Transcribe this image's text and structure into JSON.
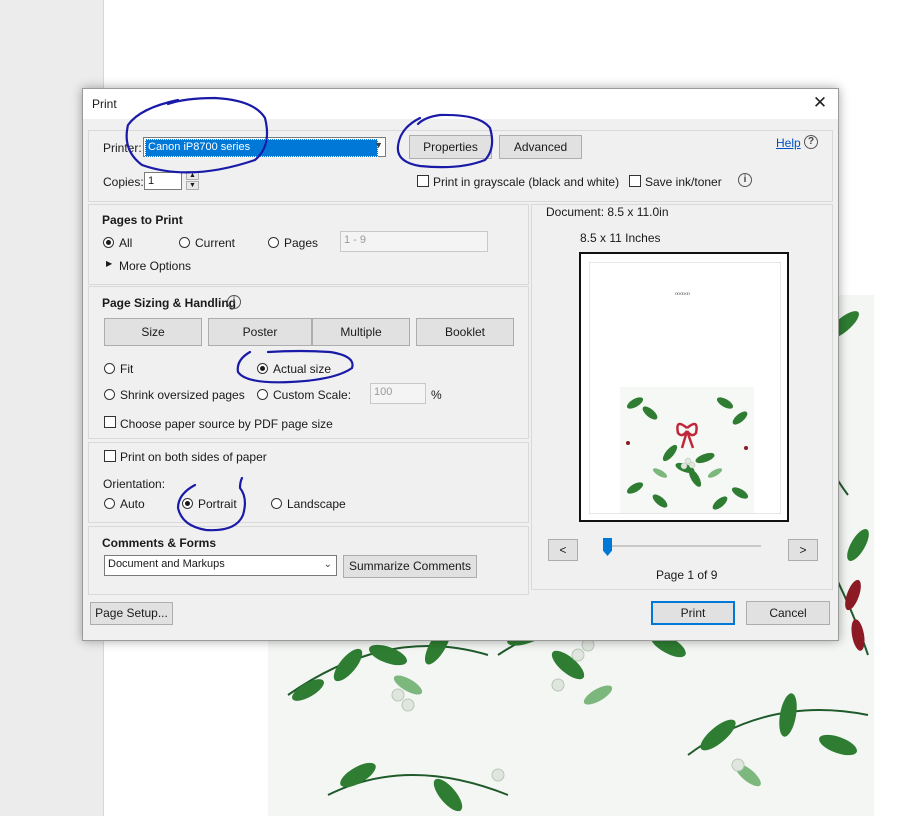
{
  "dialog": {
    "title": "Print"
  },
  "printer": {
    "label": "Printer:",
    "selected": "Canon iP8700 series",
    "properties_label": "Properties",
    "advanced_label": "Advanced",
    "help_label": "Help",
    "copies_label": "Copies:",
    "copies_value": "1",
    "grayscale_label": "Print in grayscale (black and white)",
    "grayscale_checked": false,
    "save_ink_label": "Save ink/toner",
    "save_ink_checked": false
  },
  "pages_to_print": {
    "heading": "Pages to Print",
    "all_label": "All",
    "current_label": "Current",
    "pages_label": "Pages",
    "pages_placeholder": "1 - 9",
    "more_options_label": "More Options",
    "selected": "All"
  },
  "sizing": {
    "heading": "Page Sizing & Handling",
    "tabs": [
      "Size",
      "Poster",
      "Multiple",
      "Booklet"
    ],
    "fit_label": "Fit",
    "actual_size_label": "Actual size",
    "shrink_label": "Shrink oversized pages",
    "custom_scale_label": "Custom Scale:",
    "custom_scale_value": "100",
    "percent_label": "%",
    "paper_source_label": "Choose paper source by PDF page size",
    "selected": "Actual size"
  },
  "duplex": {
    "both_sides_label": "Print on both sides of paper",
    "orientation_label": "Orientation:",
    "auto_label": "Auto",
    "portrait_label": "Portrait",
    "landscape_label": "Landscape",
    "selected": "Portrait"
  },
  "comments": {
    "heading": "Comments & Forms",
    "selected": "Document and Markups",
    "summarize_label": "Summarize Comments"
  },
  "preview": {
    "document_size": "Document: 8.5 x 11.0in",
    "paper_size": "8.5 x 11 Inches",
    "page_text": "Page 1 of 9",
    "prev_label": "<",
    "next_label": ">"
  },
  "footer": {
    "page_setup_label": "Page Setup...",
    "print_label": "Print",
    "cancel_label": "Cancel"
  },
  "colors": {
    "accent": "#0078d7",
    "annotation": "#1a1aa8",
    "leaf_green": "#2e7d32",
    "ribbon_red": "#c0283a"
  }
}
